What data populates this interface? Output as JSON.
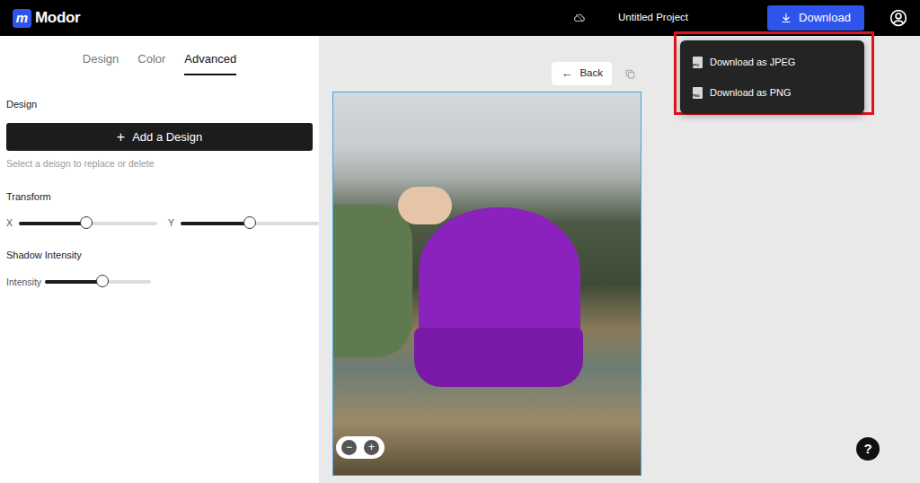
{
  "app": {
    "logo_mark": "m",
    "logo": "Modor"
  },
  "project": {
    "title": "Untitled Project"
  },
  "download_button": {
    "label": "Download"
  },
  "download_menu": {
    "items": [
      {
        "label": "Download as JPEG",
        "icon_text": "JPG"
      },
      {
        "label": "Download as PNG",
        "icon_text": "PNG"
      }
    ]
  },
  "tabs": [
    {
      "label": "Design",
      "selected": false
    },
    {
      "label": "Color",
      "selected": false
    },
    {
      "label": "Advanced",
      "selected": true
    }
  ],
  "design_section": {
    "title": "Design",
    "add_icon": "+",
    "add_button": "Add a Design",
    "hint": "Select a deisgn to replace or delete"
  },
  "transform": {
    "title": "Transform",
    "sliders": [
      {
        "label": "X",
        "level": 0.49
      },
      {
        "label": "Y",
        "level": 0.5
      }
    ]
  },
  "shadow": {
    "title": "Shadow Intensity",
    "label": "Intensity",
    "level": 0.54
  },
  "canvas": {
    "back_icon": "←",
    "back": "Back",
    "zoom_out": "−",
    "zoom_in": "+",
    "help": "?"
  }
}
